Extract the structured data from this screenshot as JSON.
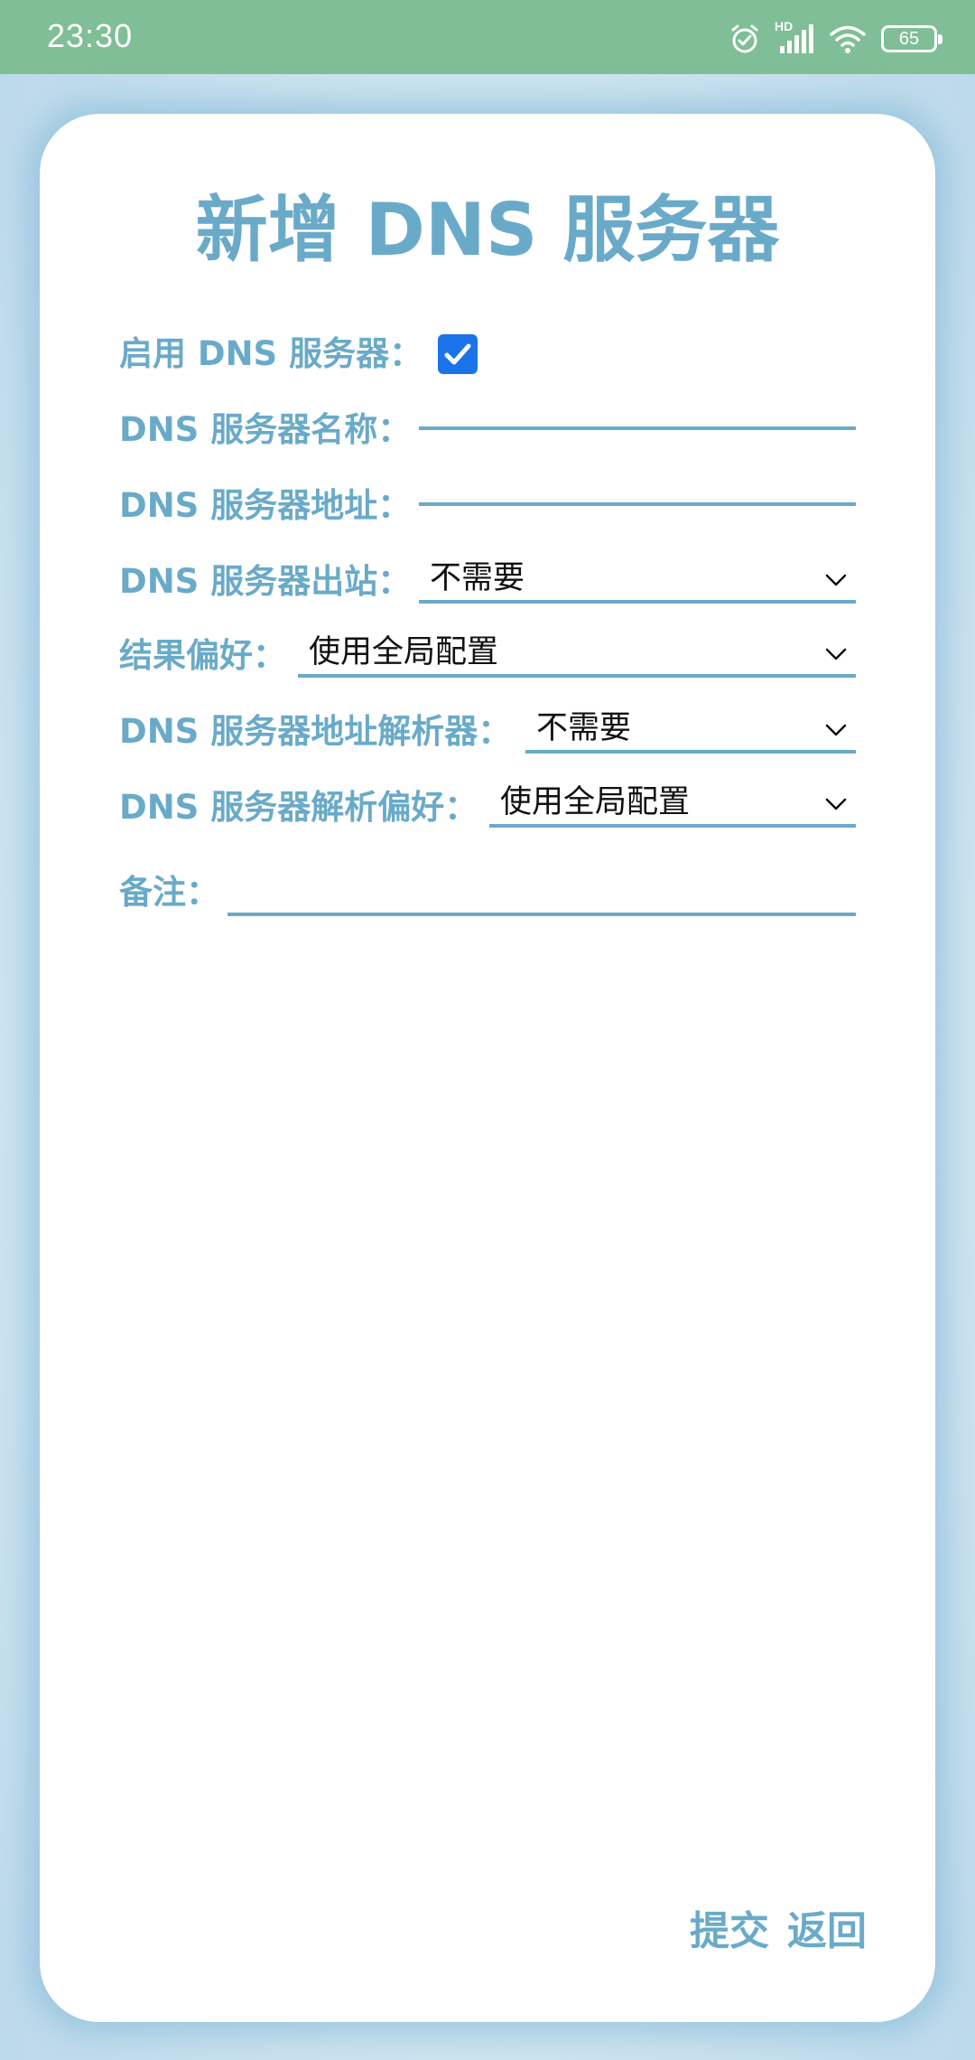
{
  "status_bar": {
    "time": "23:30",
    "network_label": "HD",
    "battery": "65",
    "icons": [
      "alarm-icon",
      "signal-icon",
      "wifi-icon",
      "battery-icon"
    ]
  },
  "colors": {
    "status_bar": "#7fbe96",
    "accent": "#6aaac9",
    "checkbox": "#1a73e8"
  },
  "form": {
    "title": "新增 DNS 服务器",
    "enabled": {
      "label": "启用 DNS 服务器：",
      "checked": true
    },
    "name": {
      "label": "DNS 服务器名称：",
      "value": ""
    },
    "address": {
      "label": "DNS 服务器地址：",
      "value": ""
    },
    "outbound": {
      "label": "DNS 服务器出站：",
      "value": "不需要"
    },
    "result_preference": {
      "label": "结果偏好：",
      "value": "使用全局配置"
    },
    "address_resolver": {
      "label": "DNS 服务器地址解析器：",
      "value": "不需要"
    },
    "resolve_preference": {
      "label": "DNS 服务器解析偏好：",
      "value": "使用全局配置"
    },
    "remark": {
      "label": "备注：",
      "value": ""
    }
  },
  "actions": {
    "submit": "提交",
    "back": "返回"
  }
}
